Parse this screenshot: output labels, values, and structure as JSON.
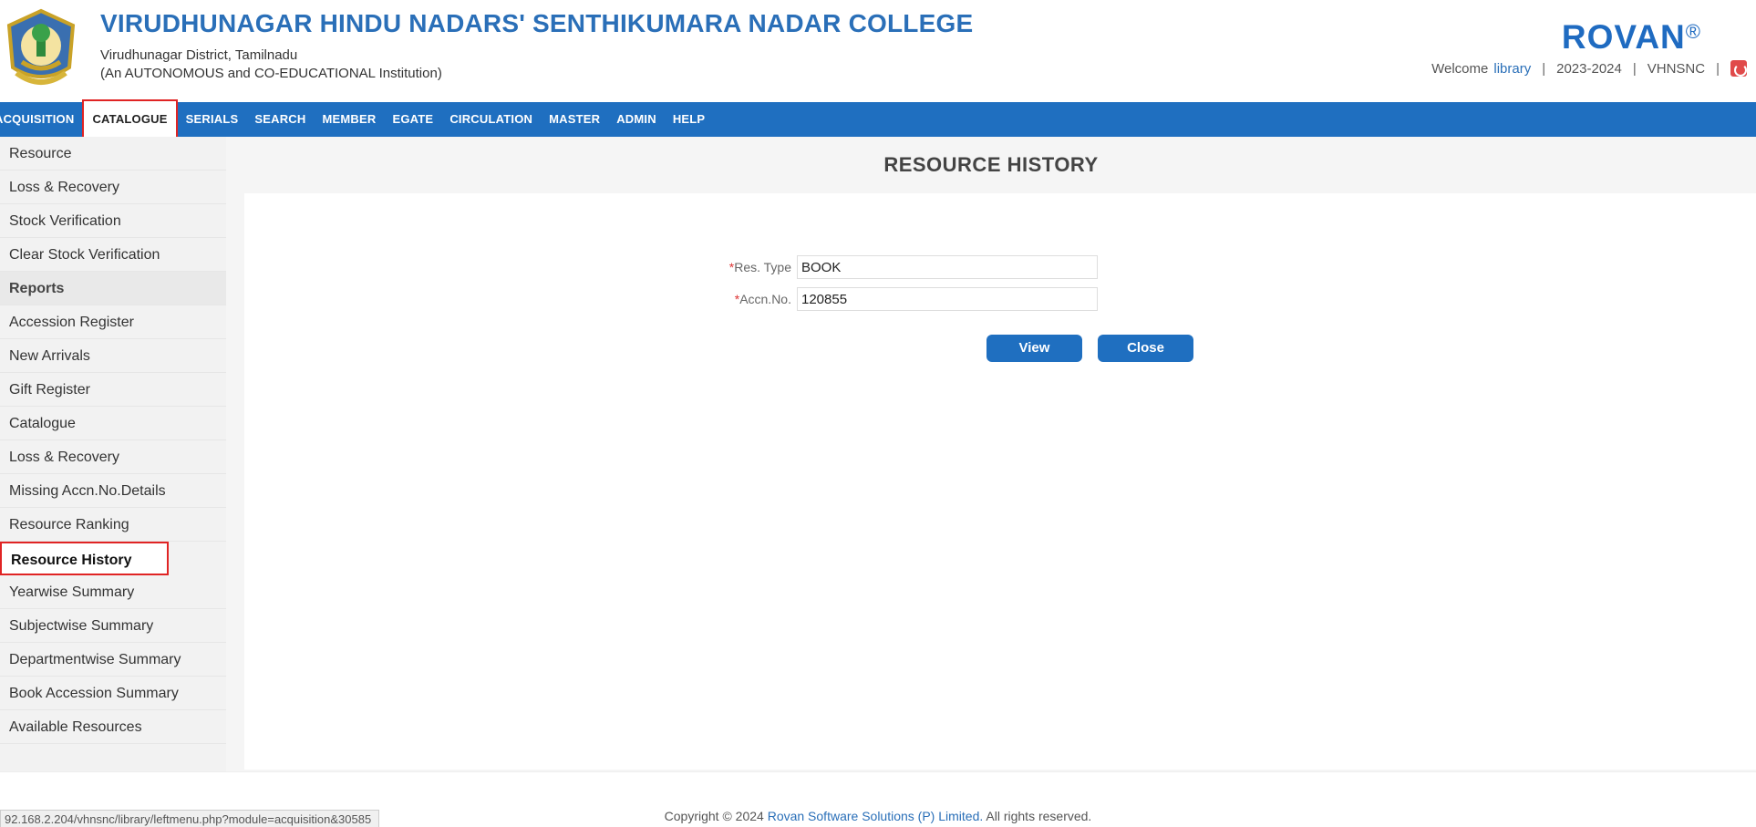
{
  "header": {
    "college_name": "VIRUDHUNAGAR HINDU NADARS' SENTHIKUMARA NADAR COLLEGE",
    "district": "Virudhunagar District, Tamilnadu",
    "institution_type": "(An AUTONOMOUS and CO-EDUCATIONAL Institution)",
    "brand": "ROVAN",
    "brand_mark": "®",
    "welcome_label": "Welcome",
    "username": "library",
    "academic_year": "2023-2024",
    "org_code": "VHNSNC"
  },
  "nav": {
    "items": [
      {
        "label": "ACQUISITION"
      },
      {
        "label": "CATALOGUE",
        "active": true
      },
      {
        "label": "SERIALS"
      },
      {
        "label": "SEARCH"
      },
      {
        "label": "MEMBER"
      },
      {
        "label": "EGATE"
      },
      {
        "label": "CIRCULATION"
      },
      {
        "label": "MASTER"
      },
      {
        "label": "ADMIN"
      },
      {
        "label": "HELP"
      }
    ]
  },
  "sidebar": {
    "items": [
      {
        "label": "Resource"
      },
      {
        "label": "Loss & Recovery"
      },
      {
        "label": "Stock Verification"
      },
      {
        "label": "Clear Stock Verification"
      },
      {
        "label": "Reports"
      },
      {
        "label": "Accession Register"
      },
      {
        "label": "New Arrivals"
      },
      {
        "label": "Gift Register"
      },
      {
        "label": "Catalogue"
      },
      {
        "label": "Loss & Recovery"
      },
      {
        "label": "Missing Accn.No.Details"
      },
      {
        "label": "Resource Ranking"
      },
      {
        "label": "Resource History"
      },
      {
        "label": "Yearwise Summary"
      },
      {
        "label": "Subjectwise Summary"
      },
      {
        "label": "Departmentwise Summary"
      },
      {
        "label": "Book Accession Summary"
      },
      {
        "label": "Available Resources"
      }
    ]
  },
  "main": {
    "title": "RESOURCE HISTORY",
    "form": {
      "res_type_label": "Res. Type",
      "res_type_value": "BOOK",
      "accn_label": "Accn.No.",
      "accn_value": "120855",
      "required_mark": "*"
    },
    "view_label": "View",
    "close_label": "Close"
  },
  "footer": {
    "status_url": "92.168.2.204/vhnsnc/library/leftmenu.php?module=acquisition&30585",
    "copyright_prefix": "Copyright © 2024",
    "company": "Rovan Software Solutions (P) Limited.",
    "rights": "All rights reserved."
  }
}
